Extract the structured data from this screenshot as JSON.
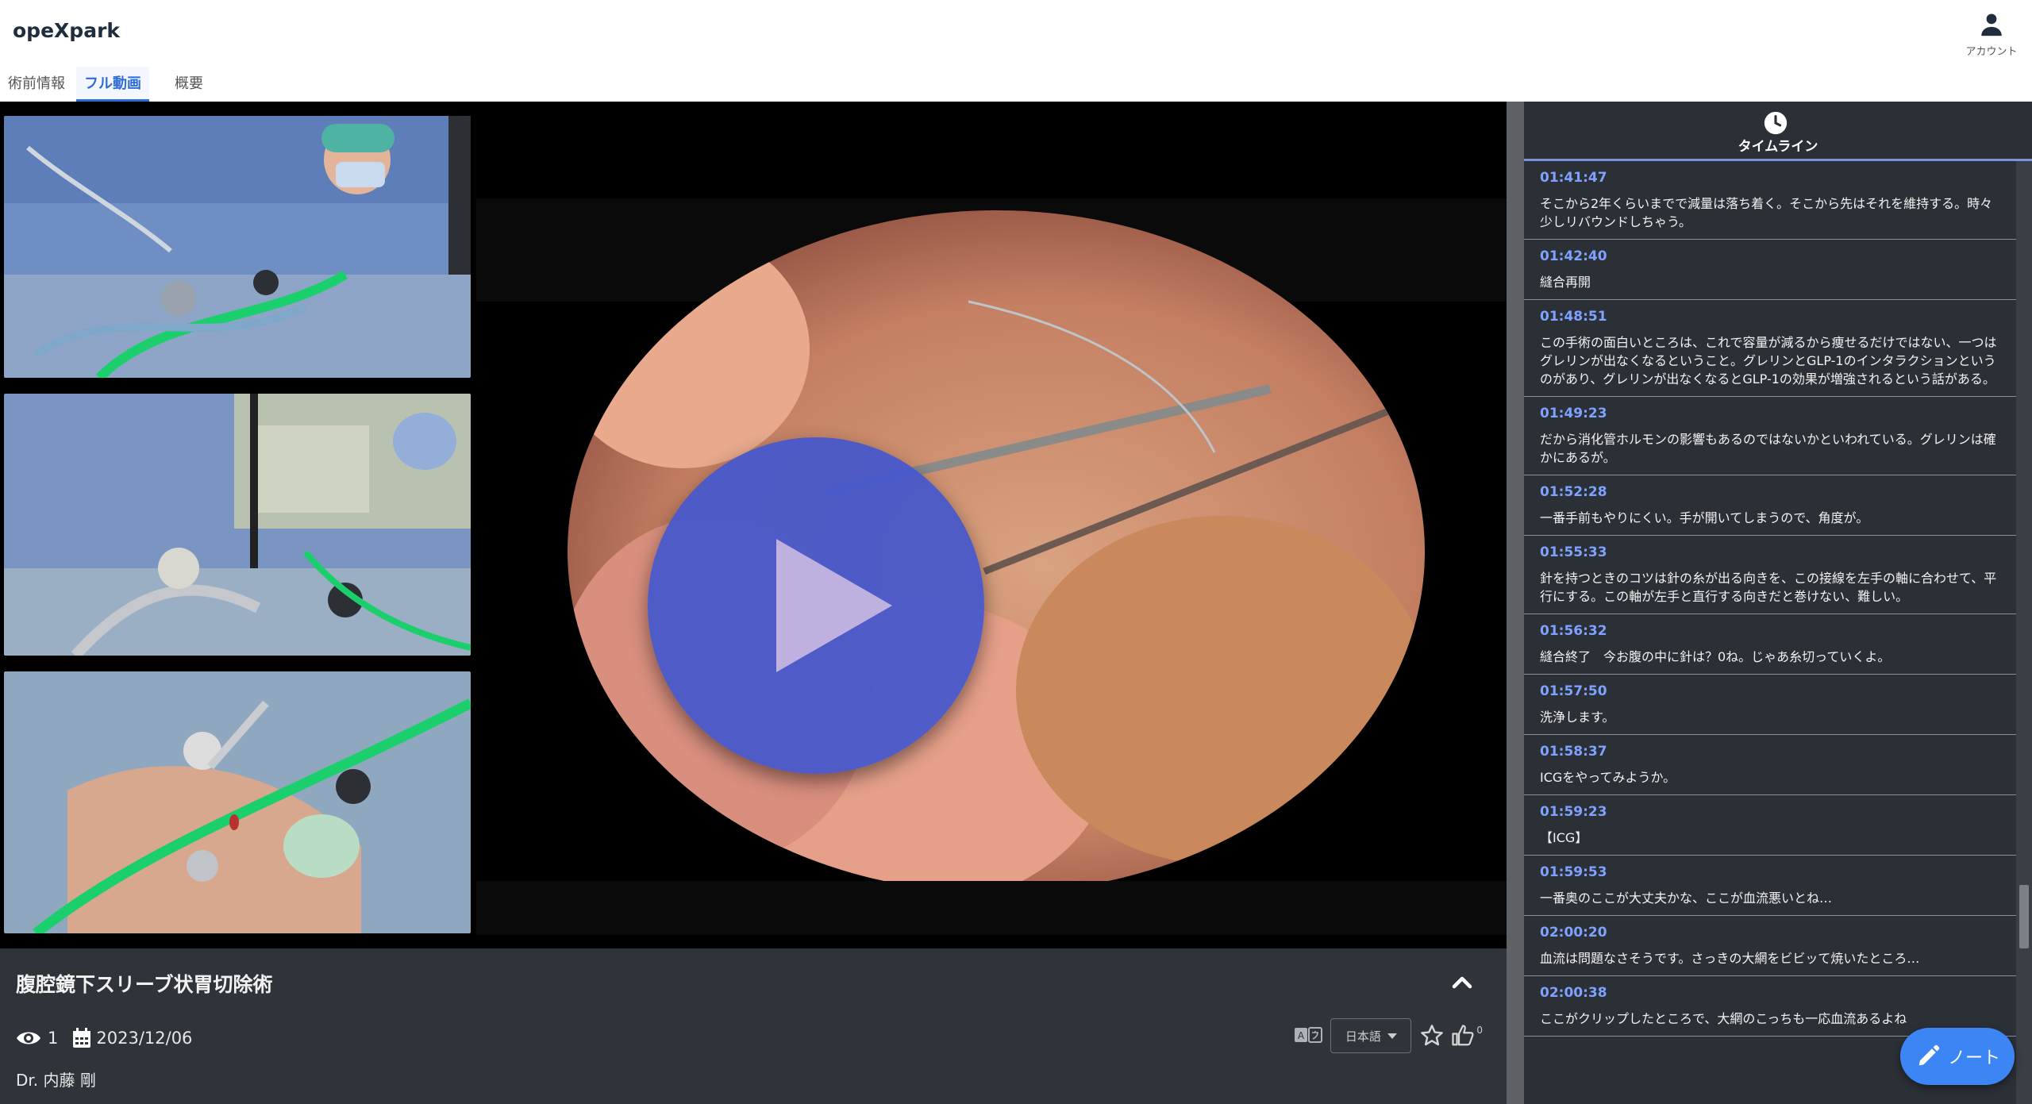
{
  "header": {
    "logo": "opeXpark",
    "account_label": "アカウント"
  },
  "tabs": [
    {
      "label": "術前情報",
      "active": false
    },
    {
      "label": "フル動画",
      "active": true
    },
    {
      "label": "概要",
      "active": false
    }
  ],
  "video": {
    "title": "腹腔鏡下スリーブ状胃切除術",
    "views": "1",
    "date": "2023/12/06",
    "doctor": "Dr. 内藤 剛",
    "language": "日本語",
    "likes": "0"
  },
  "timeline": {
    "label": "タイムライン",
    "items": [
      {
        "time": "01:41:47",
        "text": "そこから2年くらいまでで減量は落ち着く。そこから先はそれを維持する。時々少しリバウンドしちゃう。"
      },
      {
        "time": "01:42:40",
        "text": "縫合再開"
      },
      {
        "time": "01:48:51",
        "text": "この手術の面白いところは、これで容量が減るから痩せるだけではない、一つはグレリンが出なくなるということ。グレリンとGLP-1のインタラクションというのがあり、グレリンが出なくなるとGLP-1の効果が増強されるという話がある。"
      },
      {
        "time": "01:49:23",
        "text": "だから消化管ホルモンの影響もあるのではないかといわれている。グレリンは確かにあるが。"
      },
      {
        "time": "01:52:28",
        "text": "一番手前もやりにくい。手が開いてしまうので、角度が。"
      },
      {
        "time": "01:55:33",
        "text": "針を持つときのコツは針の糸が出る向きを、この接線を左手の軸に合わせて、平行にする。この軸が左手と直行する向きだと巻けない、難しい。"
      },
      {
        "time": "01:56:32",
        "text": "縫合終了　今お腹の中に針は？0ね。じゃあ糸切っていくよ。"
      },
      {
        "time": "01:57:50",
        "text": "洗浄します。"
      },
      {
        "time": "01:58:37",
        "text": "ICGをやってみようか。"
      },
      {
        "time": "01:59:23",
        "text": "【ICG】"
      },
      {
        "time": "01:59:53",
        "text": "一番奥のここが大丈夫かな、ここが血流悪いとね…"
      },
      {
        "time": "02:00:20",
        "text": "血流は問題なさそうです。さっきの大網をビビッて焼いたところ…"
      },
      {
        "time": "02:00:38",
        "text": "ここがクリップしたところで、大網のこっちも一応血流あるよね"
      }
    ]
  },
  "note_button": {
    "label": "ノート"
  },
  "colors": {
    "accent": "#2f6cd9",
    "timestamp": "#7fa2ff",
    "play_button": "#4357cd",
    "note_button": "#3b86f4",
    "panel_bg": "#2b2f36"
  }
}
